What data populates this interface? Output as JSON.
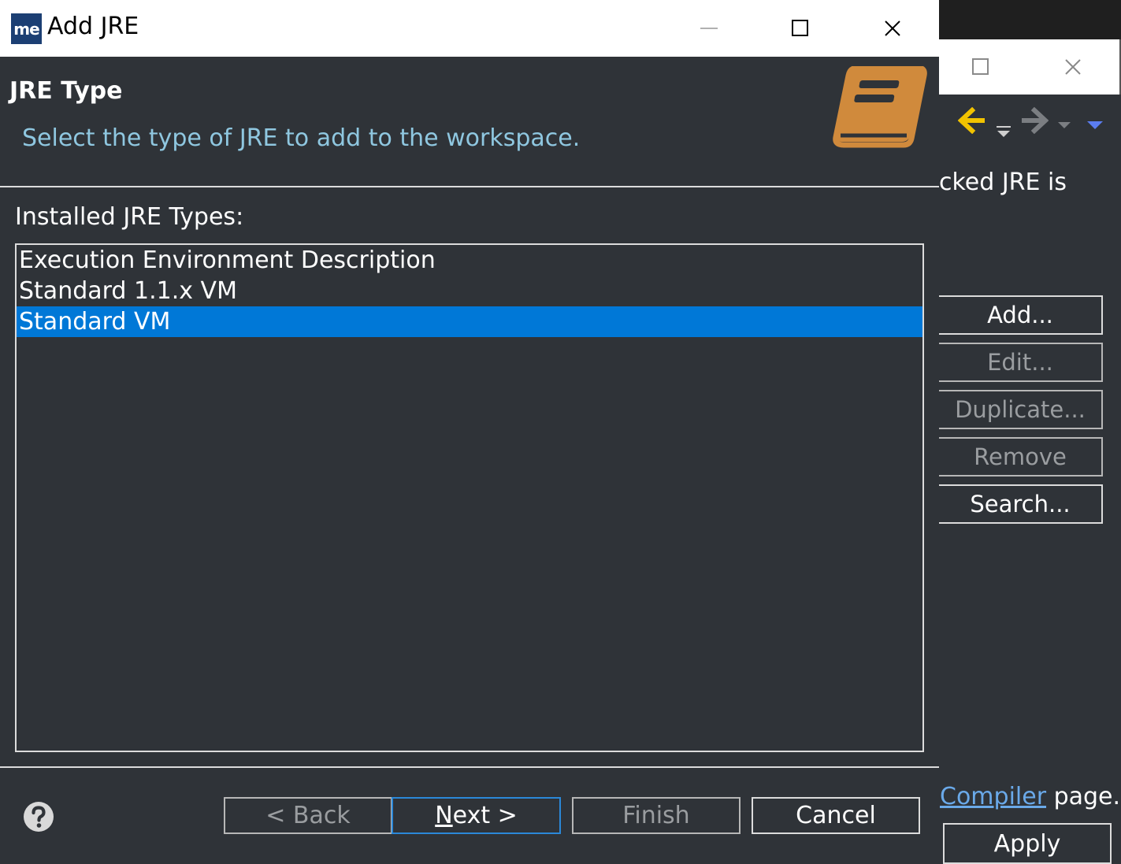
{
  "background_window": {
    "description_fragment": "cked JRE is",
    "buttons": [
      {
        "label": "Add...",
        "enabled": true
      },
      {
        "label": "Edit...",
        "enabled": false
      },
      {
        "label": "Duplicate...",
        "enabled": false
      },
      {
        "label": "Remove",
        "enabled": false
      },
      {
        "label": "Search...",
        "enabled": true
      }
    ],
    "footer_link": "Compiler",
    "footer_text": " page.",
    "apply_label": "Apply"
  },
  "dialog": {
    "title": "Add JRE",
    "logo_text": "me",
    "page_title": "JRE Type",
    "page_description": "Select the type of JRE to add to the workspace.",
    "list_label": "Installed JRE Types:",
    "jre_types": [
      {
        "label": "Execution Environment Description",
        "selected": false
      },
      {
        "label": "Standard 1.1.x VM",
        "selected": false
      },
      {
        "label": "Standard VM",
        "selected": true
      }
    ],
    "buttons": {
      "back": "< Back",
      "next_mnemonic": "N",
      "next_rest": "ext >",
      "finish": "Finish",
      "cancel": "Cancel"
    }
  },
  "colors": {
    "background": "#2f3338",
    "selection": "#0078d7",
    "description_text": "#8fc7e0",
    "book_icon": "#d08a3c",
    "nav_back_arrow": "#f2c300",
    "link": "#6aa9e9"
  },
  "icons": {
    "help": "help-question-icon",
    "banner": "book-icon",
    "nav_back": "arrow-left-icon",
    "nav_forward": "arrow-right-icon"
  }
}
